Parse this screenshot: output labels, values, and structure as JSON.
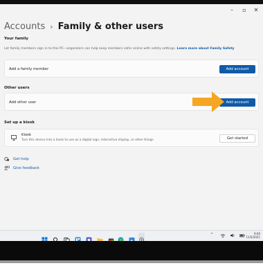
{
  "window": {
    "controls": {
      "minimize": "–",
      "maximize": "▫",
      "close": "✕"
    }
  },
  "breadcrumb": {
    "parent": "Accounts",
    "separator": "›",
    "current": "Family & other users"
  },
  "your_family": {
    "heading": "Your family",
    "description": "Let family members sign in to this PC—organizers can help keep members safer online with safety settings.",
    "learn_more": "Learn more about Family Safety",
    "row_label": "Add a family member",
    "button": "Add account"
  },
  "other_users": {
    "heading": "Other users",
    "row_label": "Add other user",
    "button": "Add account"
  },
  "kiosk": {
    "heading": "Set up a kiosk",
    "title": "Kiosk",
    "description": "Turn this device into a kiosk to use as a digital sign, interactive display, or other things",
    "button": "Get started"
  },
  "help": {
    "get_help": "Get help",
    "give_feedback": "Give feedback"
  },
  "annotation": {
    "color": "#f5a623"
  },
  "taskbar": {
    "icons": [
      "windows-start-icon",
      "search-icon",
      "task-view-icon",
      "widgets-icon",
      "chat-icon",
      "file-explorer-icon",
      "store-icon",
      "edge-icon",
      "photos-icon",
      "settings-icon"
    ],
    "tray": {
      "chevron": "^",
      "wifi": "wifi",
      "volume": "volume",
      "battery": "battery"
    },
    "clock": {
      "time": "9:00",
      "date": "11/5/2021"
    }
  },
  "colors": {
    "accent": "#0f5aa8",
    "window_bg": "#f3f3f3",
    "card_bg": "#fbfbfb"
  }
}
